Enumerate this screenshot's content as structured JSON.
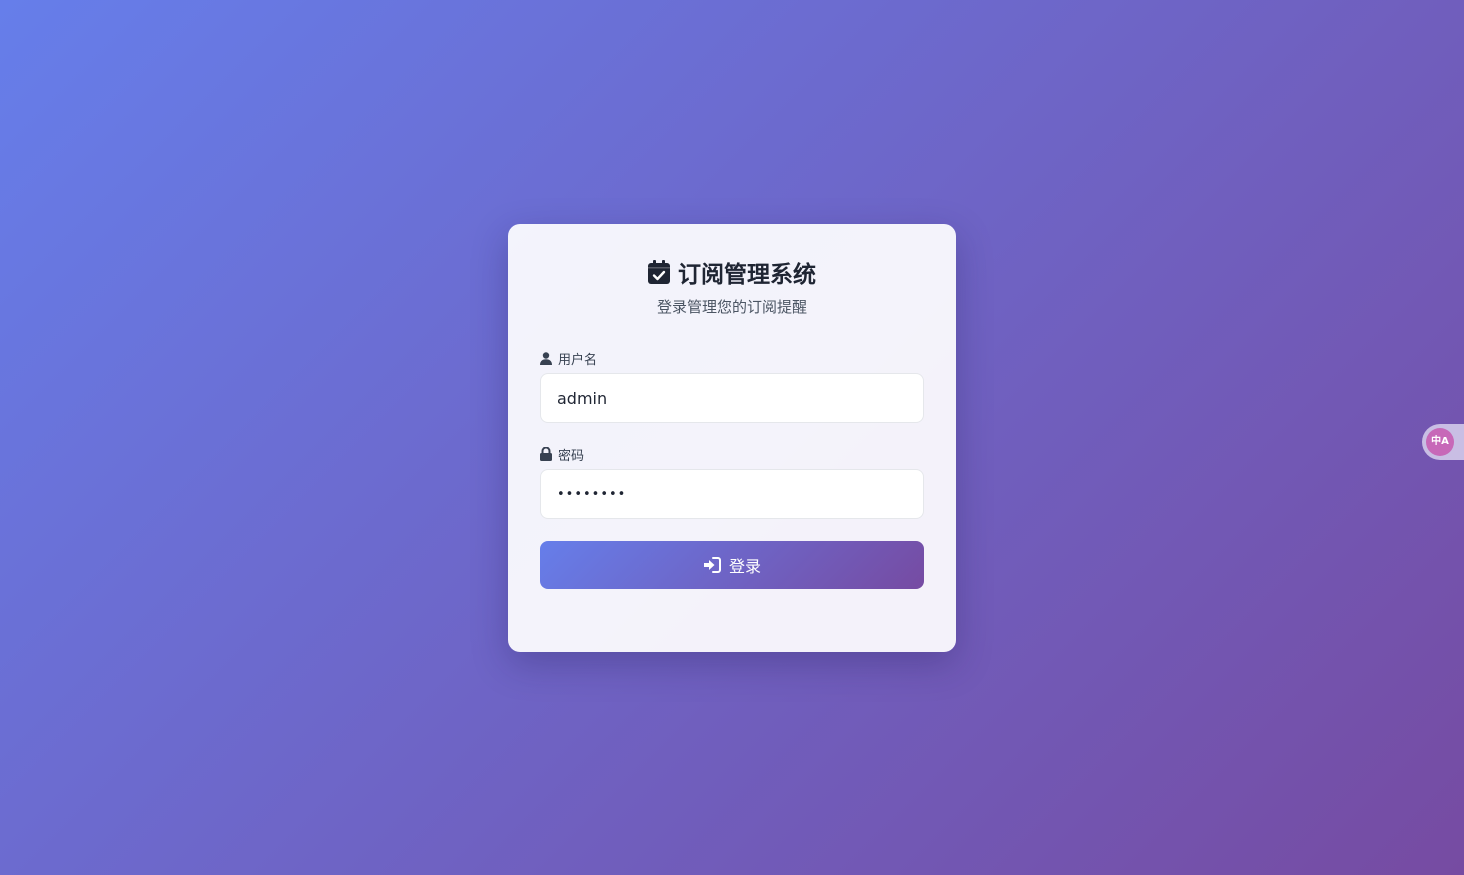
{
  "app": {
    "title": "订阅管理系统",
    "subtitle": "登录管理您的订阅提醒",
    "title_icon": "calendar-check-icon"
  },
  "form": {
    "username": {
      "label": "用户名",
      "icon": "user-icon",
      "value": "admin"
    },
    "password": {
      "label": "密码",
      "icon": "lock-icon",
      "value": "••••••••"
    },
    "submit": {
      "label": "登录",
      "icon": "sign-in-icon"
    }
  },
  "translate_widget": {
    "text": "中A",
    "icon": "translate-icon"
  },
  "colors": {
    "gradient_start": "#667eea",
    "gradient_end": "#764ba2",
    "text_dark": "#1f2533"
  }
}
